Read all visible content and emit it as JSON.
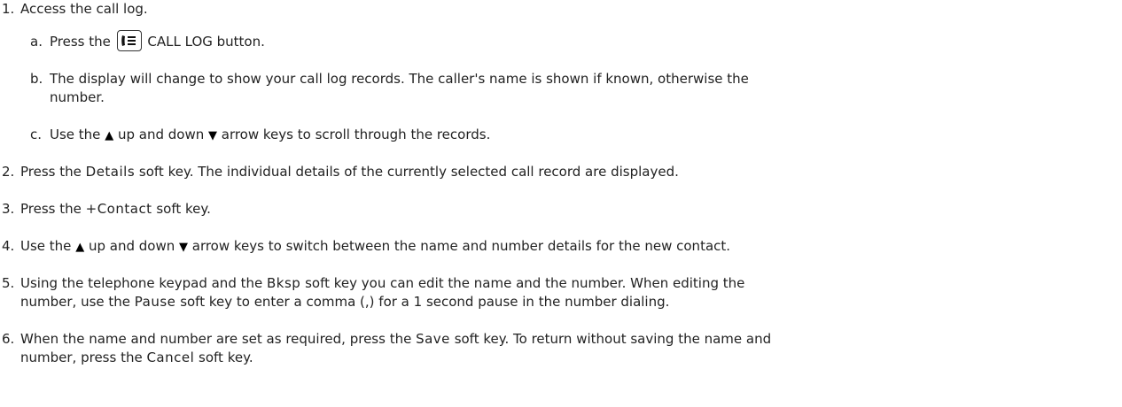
{
  "steps": {
    "s1": {
      "num": "1.",
      "text": "Access the call log."
    },
    "s1a": {
      "num": "a.",
      "pre": "Press the ",
      "icon": "call-log-icon",
      "post": " CALL LOG button."
    },
    "s1b": {
      "num": "b.",
      "line1": "The display will change to show your call log records. The caller's name is shown if known, otherwise the",
      "line2": "number."
    },
    "s1c": {
      "num": "c.",
      "pre": "Use the ",
      "up": "▲",
      "mid": " up and down ",
      "down": "▼",
      "post": " arrow keys to scroll through the records."
    },
    "s2": {
      "num": "2.",
      "pre": "Press the ",
      "key": "Details",
      "post": " soft key. The individual details of the currently selected call record are displayed."
    },
    "s3": {
      "num": "3.",
      "pre": "Press the ",
      "key": "+Contact",
      "post": " soft key."
    },
    "s4": {
      "num": "4.",
      "pre": "Use the ",
      "up": "▲",
      "mid": " up and down ",
      "down": "▼",
      "post": " arrow keys to switch between the name and number details for the new contact."
    },
    "s5": {
      "num": "5.",
      "pre": "Using the telephone keypad and the ",
      "key1": "Bksp",
      "mid": " soft key you can edit the name and the number. When editing the",
      "line2pre": "number, use the ",
      "key2": "Pause",
      "line2post": " soft key to enter a comma (,) for a 1 second pause in the number dialing."
    },
    "s6": {
      "num": "6.",
      "pre": "When the name and number are set as required, press the ",
      "key1": "Save",
      "mid": " soft key. To return without saving the name and",
      "line2pre": "number, press the ",
      "key2": "Cancel",
      "line2post": " soft key."
    }
  }
}
